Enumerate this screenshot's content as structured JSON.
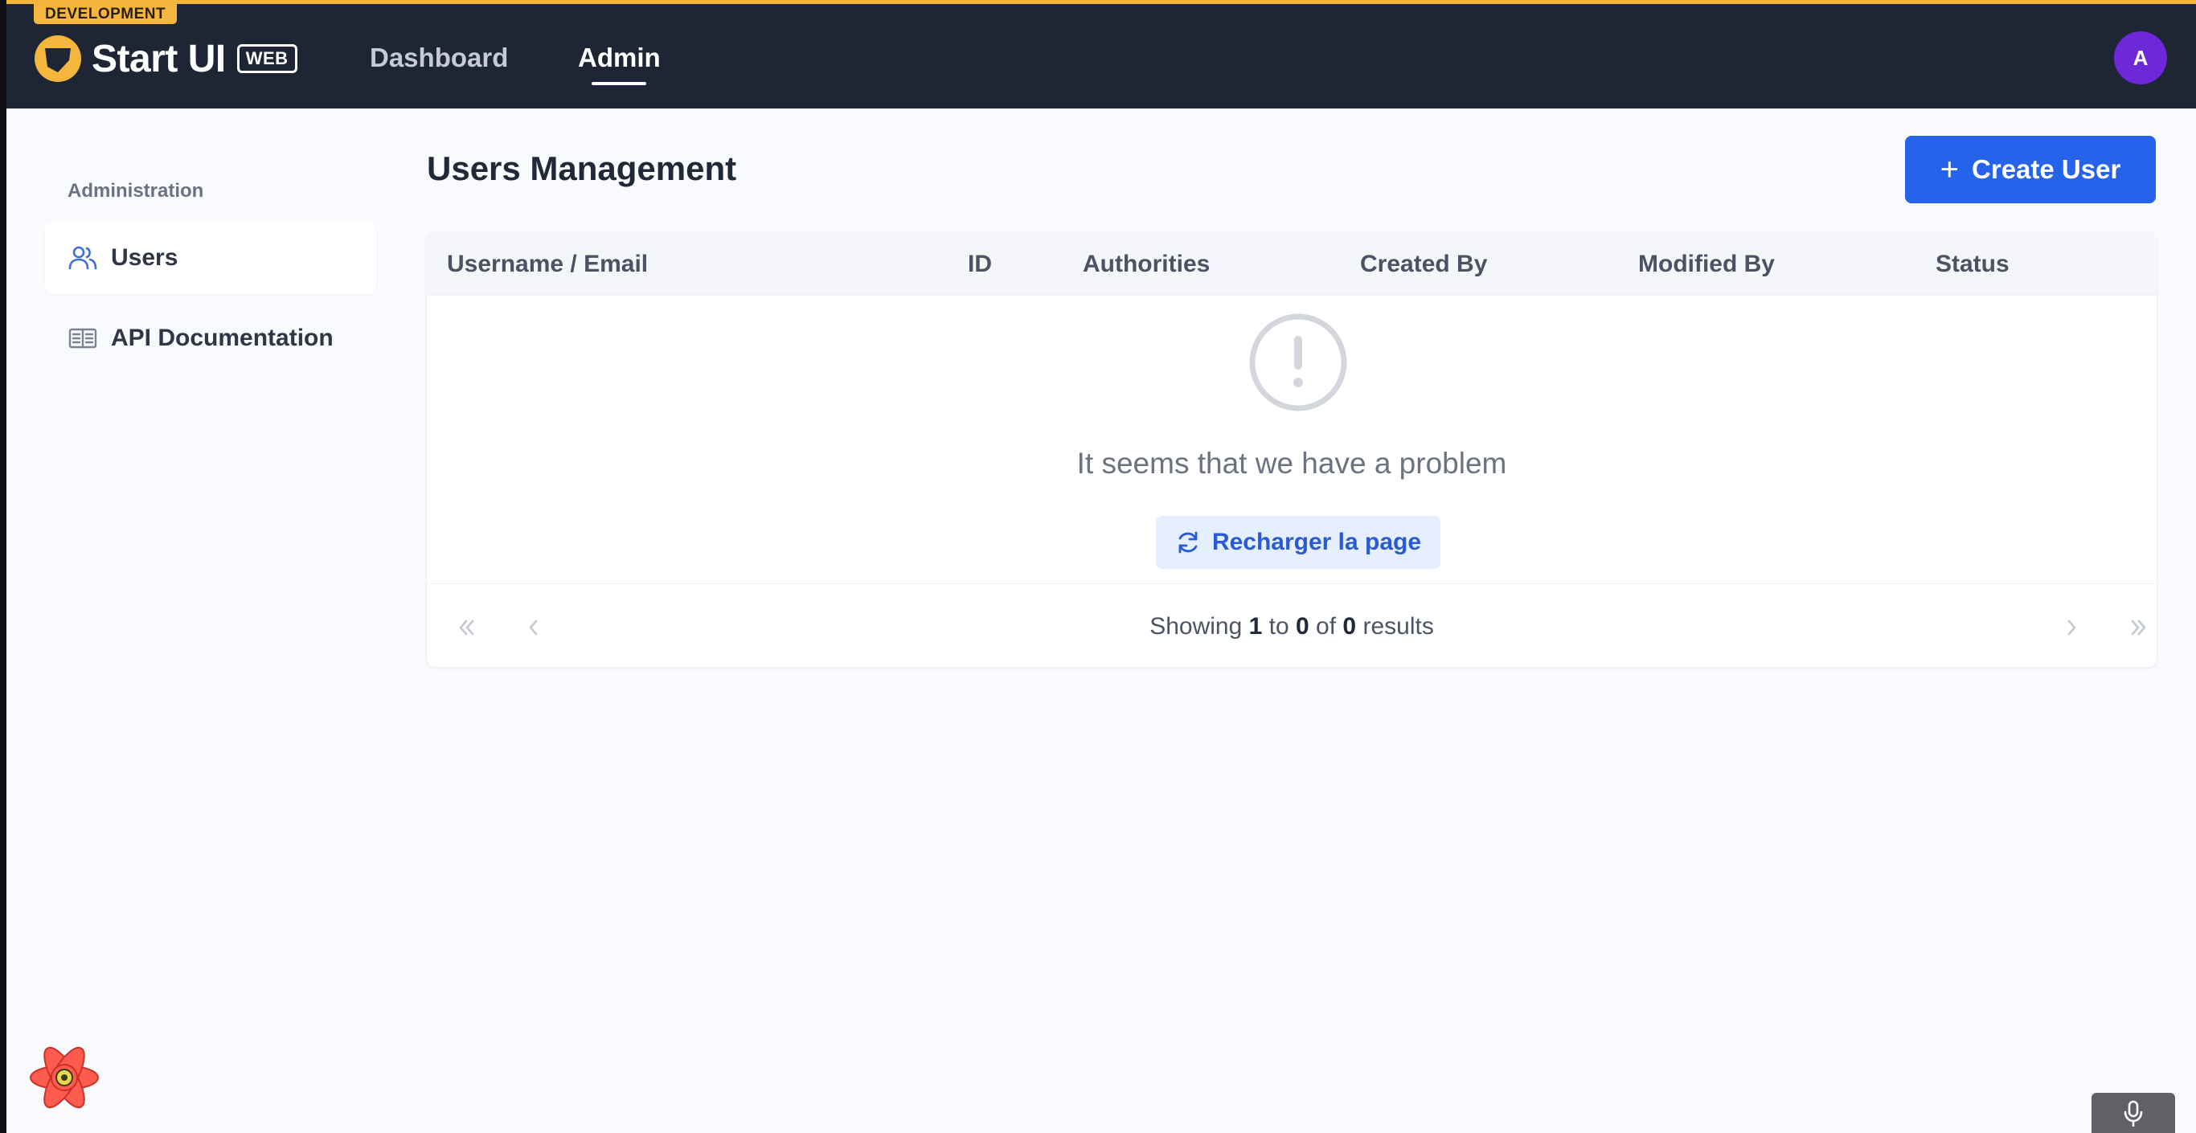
{
  "app": {
    "env_badge": "DEVELOPMENT",
    "brand_name": "Start UI",
    "brand_tag": "WEB"
  },
  "nav": {
    "items": [
      {
        "label": "Dashboard",
        "active": false
      },
      {
        "label": "Admin",
        "active": true
      }
    ],
    "avatar_initial": "A"
  },
  "sidebar": {
    "heading": "Administration",
    "items": [
      {
        "label": "Users",
        "icon": "users-icon",
        "active": true
      },
      {
        "label": "API Documentation",
        "icon": "book-icon",
        "active": false
      }
    ]
  },
  "main": {
    "title": "Users Management",
    "create_button": "Create User",
    "table": {
      "columns": [
        "Username / Email",
        "ID",
        "Authorities",
        "Created By",
        "Modified By",
        "Status"
      ],
      "rows": []
    },
    "error": {
      "message": "It seems that we have a problem",
      "reload_button": "Recharger la page"
    },
    "pagination": {
      "prefix": "Showing",
      "from": "1",
      "to_word": "to",
      "to": "0",
      "of_word": "of",
      "total": "0",
      "suffix": "results"
    }
  },
  "colors": {
    "topbar": "#1e2535",
    "accent_bar": "#f2b43b",
    "primary": "#2563eb",
    "avatar": "#6d28d9"
  }
}
